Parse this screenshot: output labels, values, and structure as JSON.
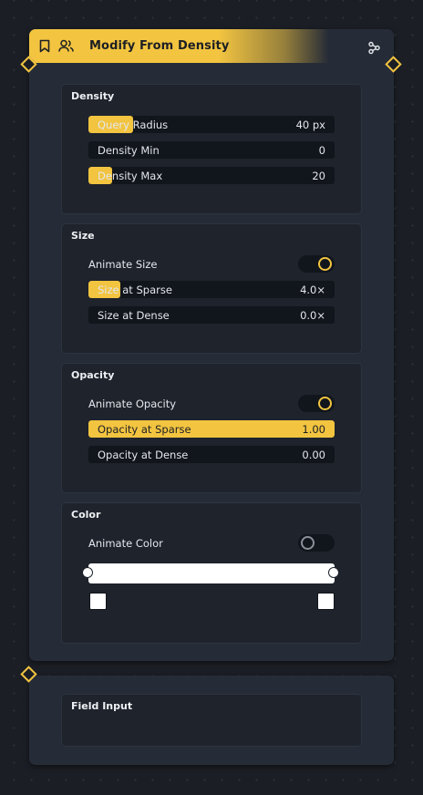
{
  "node": {
    "title": "Modify From Density",
    "header_icons": [
      "bookmark-icon",
      "users-icon"
    ],
    "action_icon": "share-nodes-icon"
  },
  "sections": {
    "density": {
      "title": "Density",
      "fields": [
        {
          "label": "Query Radius",
          "value": "40 px",
          "fill_fraction": 0.18
        },
        {
          "label": "Density Min",
          "value": "0",
          "fill_fraction": 0.0
        },
        {
          "label": "Density Max",
          "value": "20",
          "fill_fraction": 0.1
        }
      ]
    },
    "size": {
      "title": "Size",
      "toggle": {
        "label": "Animate Size",
        "on": true
      },
      "fields": [
        {
          "label": "Size at Sparse",
          "value": "4.0×",
          "fill_fraction": 0.13
        },
        {
          "label": "Size at Dense",
          "value": "0.0×",
          "fill_fraction": 0.0
        }
      ]
    },
    "opacity": {
      "title": "Opacity",
      "toggle": {
        "label": "Animate Opacity",
        "on": true
      },
      "fields": [
        {
          "label": "Opacity at Sparse",
          "value": "1.00",
          "fill_fraction": 1.0
        },
        {
          "label": "Opacity at Dense",
          "value": "0.00",
          "fill_fraction": 0.0
        }
      ]
    },
    "color": {
      "title": "Color",
      "toggle": {
        "label": "Animate Color",
        "on": false
      },
      "gradient": {
        "start_color": "#ffffff",
        "end_color": "#ffffff"
      }
    }
  },
  "field_node": {
    "title": "Field Input"
  },
  "colors": {
    "accent": "#f2c440",
    "node_bg": "#262c37",
    "panel_bg": "#1e232c",
    "field_bg": "#11151c",
    "canvas_bg": "#1b1e25"
  }
}
